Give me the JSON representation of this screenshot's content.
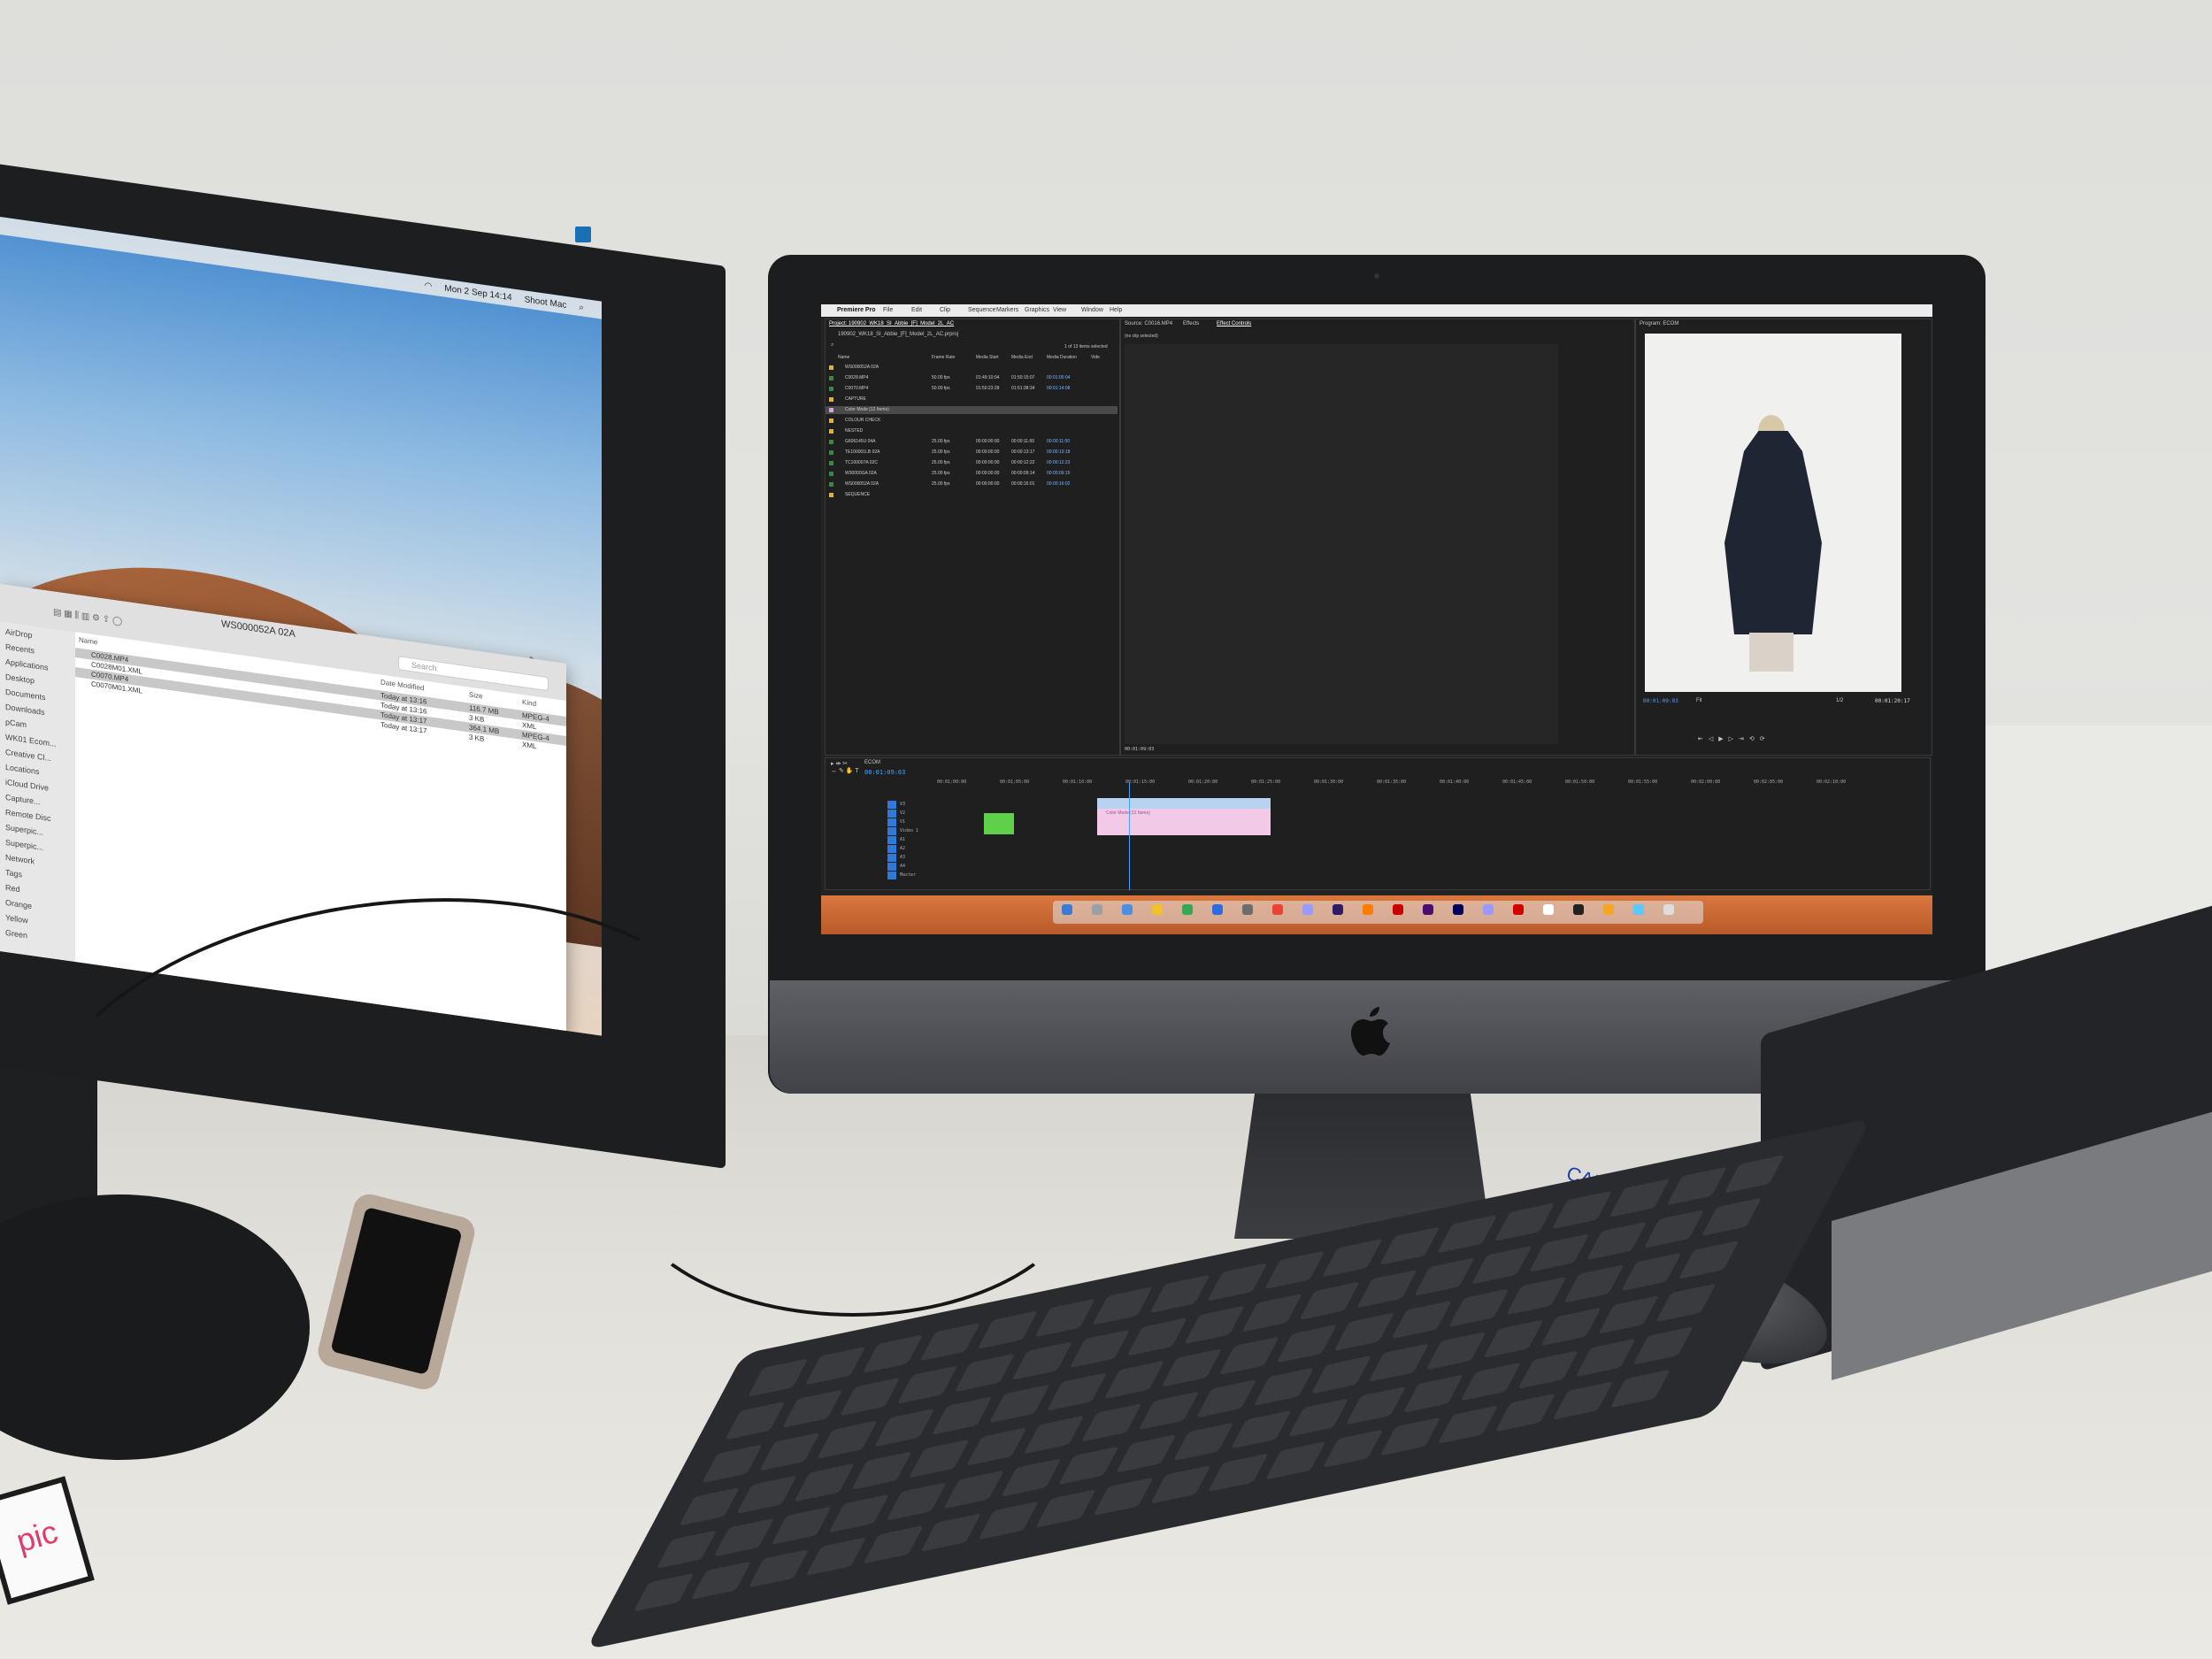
{
  "eizo": {
    "menubar": {
      "clock": "Mon 2 Sep 14:14",
      "user": "Shoot Mac"
    },
    "finder": {
      "title": "WS000052A 02A",
      "search_placeholder": "Search",
      "columns": {
        "name": "Name",
        "modified": "Date Modified",
        "size": "Size",
        "kind": "Kind"
      },
      "rows": [
        {
          "name": "C0028.MP4",
          "modified": "Today at 13:16",
          "size": "116.7 MB",
          "kind": "MPEG-4",
          "selected": true
        },
        {
          "name": "C0028M01.XML",
          "modified": "Today at 13:16",
          "size": "3 KB",
          "kind": "XML",
          "selected": false
        },
        {
          "name": "C0070.MP4",
          "modified": "Today at 13:17",
          "size": "364.1 MB",
          "kind": "MPEG-4",
          "selected": true
        },
        {
          "name": "C0070M01.XML",
          "modified": "Today at 13:17",
          "size": "3 KB",
          "kind": "XML",
          "selected": false
        }
      ],
      "sidebar": [
        "AirDrop",
        "Recents",
        "Applications",
        "Desktop",
        "Documents",
        "Downloads",
        "pCam",
        "WK01 Ecom...",
        "Creative Cl...",
        "Locations",
        "iCloud Drive",
        "Capture...",
        "Remote Disc",
        "Superpic...",
        "Superpic...",
        "Network",
        "Tags",
        "Red",
        "Orange",
        "Yellow",
        "Green"
      ]
    }
  },
  "premiere": {
    "menubar": {
      "app": "Premiere Pro",
      "items": [
        "File",
        "Edit",
        "Clip",
        "Sequence",
        "Markers",
        "Graphics",
        "View",
        "Window",
        "Help"
      ]
    },
    "project_panel": {
      "title": "Project: 190902_WK18_SI_Abbie_[F]_Model_2L_AC",
      "file": "190902_WK18_SI_Abbie_[F]_Model_2L_AC.prproj",
      "count": "1 of 13 items selected",
      "columns": [
        "Name",
        "Frame Rate",
        "Media Start",
        "Media End",
        "Media Duration",
        "Vide"
      ],
      "rows": [
        {
          "name": "WS000052A 02A",
          "rate": "",
          "start": "",
          "end": "",
          "dur": "",
          "color": "#e6b12b",
          "selected": false
        },
        {
          "name": "C0028.MP4",
          "rate": "50.00 fps",
          "start": "01:49:10:04",
          "end": "01:50:15:07",
          "dur": "00:01:05:04",
          "color": "#2f8e3e",
          "selected": false
        },
        {
          "name": "C0070.MP4",
          "rate": "50.00 fps",
          "start": "01:50:23:28",
          "end": "01:51:38:34",
          "dur": "00:01:14:08",
          "color": "#2f8e3e",
          "selected": false
        },
        {
          "name": "CAPTURE",
          "rate": "",
          "start": "",
          "end": "",
          "dur": "",
          "color": "#e6b12b",
          "selected": false
        },
        {
          "name": "Color Mode (12 Items)",
          "rate": "",
          "start": "",
          "end": "",
          "dur": "",
          "color": "#d8a3d8",
          "selected": true
        },
        {
          "name": "COLOUR CHECK",
          "rate": "",
          "start": "",
          "end": "",
          "dur": "",
          "color": "#e6b12b",
          "selected": false
        },
        {
          "name": "NESTED",
          "rate": "",
          "start": "",
          "end": "",
          "dur": "",
          "color": "#e6b12b",
          "selected": false
        },
        {
          "name": "G606145U 04A",
          "rate": "25.00 fps",
          "start": "00:00:00:00",
          "end": "00:00:11:00",
          "dur": "00:00:11:00",
          "color": "#2f8e3e",
          "selected": false
        },
        {
          "name": "TE100001LB 02A",
          "rate": "25.00 fps",
          "start": "00:00:00:00",
          "end": "00:00:13:17",
          "dur": "00:00:13:18",
          "color": "#2f8e3e",
          "selected": false
        },
        {
          "name": "TC100007A 02C",
          "rate": "25.00 fps",
          "start": "00:00:00:00",
          "end": "00:00:12:22",
          "dur": "00:00:12:23",
          "color": "#2f8e3e",
          "selected": false
        },
        {
          "name": "W30000GA 02A",
          "rate": "25.00 fps",
          "start": "00:00:00:00",
          "end": "00:00:09:14",
          "dur": "00:00:09:15",
          "color": "#2f8e3e",
          "selected": false
        },
        {
          "name": "WS000052A 02A",
          "rate": "25.00 fps",
          "start": "00:00:00:00",
          "end": "00:00:16:01",
          "dur": "00:00:16:02",
          "color": "#2f8e3e",
          "selected": false
        },
        {
          "name": "SEQUENCE",
          "rate": "",
          "start": "",
          "end": "",
          "dur": "",
          "color": "#e6b12b",
          "selected": false
        }
      ]
    },
    "source_panel": {
      "tabs": [
        "Source: C0016.MP4",
        "Effects",
        "Effect Controls"
      ],
      "active_tab": "Effect Controls",
      "empty": "(no clip selected)",
      "timecode": "00:01:09:03"
    },
    "program_panel": {
      "title": "Program: ECOM",
      "timecode_left": "00:01:09:03",
      "fit": "Fit",
      "quality": "1/2",
      "timecode_right": "00:01:20:17"
    },
    "timeline": {
      "title": "ECOM",
      "timecode": "00:01:09:03",
      "ruler": [
        "00:01:00:00",
        "00:01:05:00",
        "00:01:10:00",
        "00:01:15:00",
        "00:01:20:00",
        "00:01:25:00",
        "00:01:30:00",
        "00:01:35:00",
        "00:01:40:00",
        "00:01:45:00",
        "00:01:50:00",
        "00:01:55:00",
        "00:02:00:00",
        "00:02:05:00",
        "00:02:10:00"
      ],
      "pink_clip_label": "Color Mode (12 Items)",
      "track_labels": [
        "V3",
        "V2",
        "V1",
        "Video 1",
        "A1",
        "A2",
        "A3",
        "A4",
        "Master"
      ]
    },
    "dock_icons": [
      "#3a7bd5",
      "#9aa0a6",
      "#4a90e2",
      "#f2c12e",
      "#34a853",
      "#2d6cdf",
      "#6d6d6d",
      "#ea4335",
      "#9999ff",
      "#2f1c66",
      "#ff7c00",
      "#cc0000",
      "#4b0e70",
      "#00005b",
      "#9999ff",
      "#d40000",
      "#ffffff",
      "#222222",
      "#f5a623",
      "#5ac8fa",
      "#dddddd"
    ]
  },
  "desk": {
    "sd_card_brand": "pic",
    "card_reader_label": "CAM"
  }
}
